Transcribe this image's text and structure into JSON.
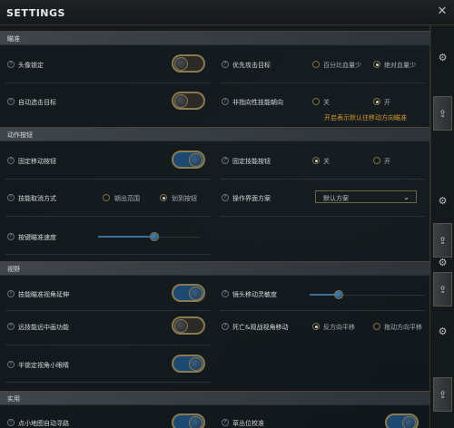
{
  "window": {
    "title": "SETTINGS",
    "close_glyph": "✕"
  },
  "sections": {
    "aim": "瞄准",
    "action": "动作按钮",
    "view": "视野",
    "utility": "实用"
  },
  "settings": {
    "head_lock": {
      "label": "头像锁定",
      "state": "off"
    },
    "priority_target": {
      "label": "优先攻击目标",
      "options": [
        "百分比血量少",
        "绝对血量少"
      ],
      "selected": 1
    },
    "auto_target": {
      "label": "自动选击目标",
      "state": "off"
    },
    "nondirectional": {
      "label": "非指向性技能朝向",
      "options": [
        "关",
        "开"
      ],
      "selected": 1
    },
    "nondirectional_tip": "开启表示默认往移动方向瞄准",
    "fixed_move_button": {
      "label": "固定移动按钮",
      "state": "on"
    },
    "fixed_skill_button": {
      "label": "固定技能按钮",
      "options": [
        "关",
        "开"
      ],
      "selected": 0
    },
    "skill_cancel_mode": {
      "label": "技能取消方式",
      "options": [
        "朝出范围",
        "划到按钮"
      ],
      "selected": 1
    },
    "control_scheme": {
      "label": "操作界面方案",
      "value": "默认方案"
    },
    "aim_speed": {
      "label": "按键瞄准速度",
      "value": 0.55
    },
    "aim_view_extend": {
      "label": "技能瞄准视角延伸",
      "state": "on"
    },
    "camera_sensitivity": {
      "label": "镜头移动灵敏度",
      "value": 0.25
    },
    "longrange_aim": {
      "label": "远技能远中画功能",
      "state": "off"
    },
    "death_camera": {
      "label": "死亡&观战视角移动",
      "options": [
        "反方向平移",
        "拖动方向平移"
      ],
      "selected": 0
    },
    "half_lock_minimap": {
      "label": "半锁定视角小眼睛",
      "state": "on"
    },
    "minimap_autopath": {
      "label": "点小地图自动寻路",
      "state": "on"
    },
    "item_check": {
      "label": "草丛位校准",
      "state": "on"
    }
  },
  "rail": {
    "icons": [
      "gear-icon",
      "upload-icon",
      "gear-icon",
      "upload-icon",
      "gear-icon",
      "upload-icon",
      "gear-icon",
      "upload-icon"
    ]
  },
  "colors": {
    "accent_blue": "#1d4a72",
    "gold_border": "#8a7a50",
    "tip_orange": "#d3962e"
  }
}
